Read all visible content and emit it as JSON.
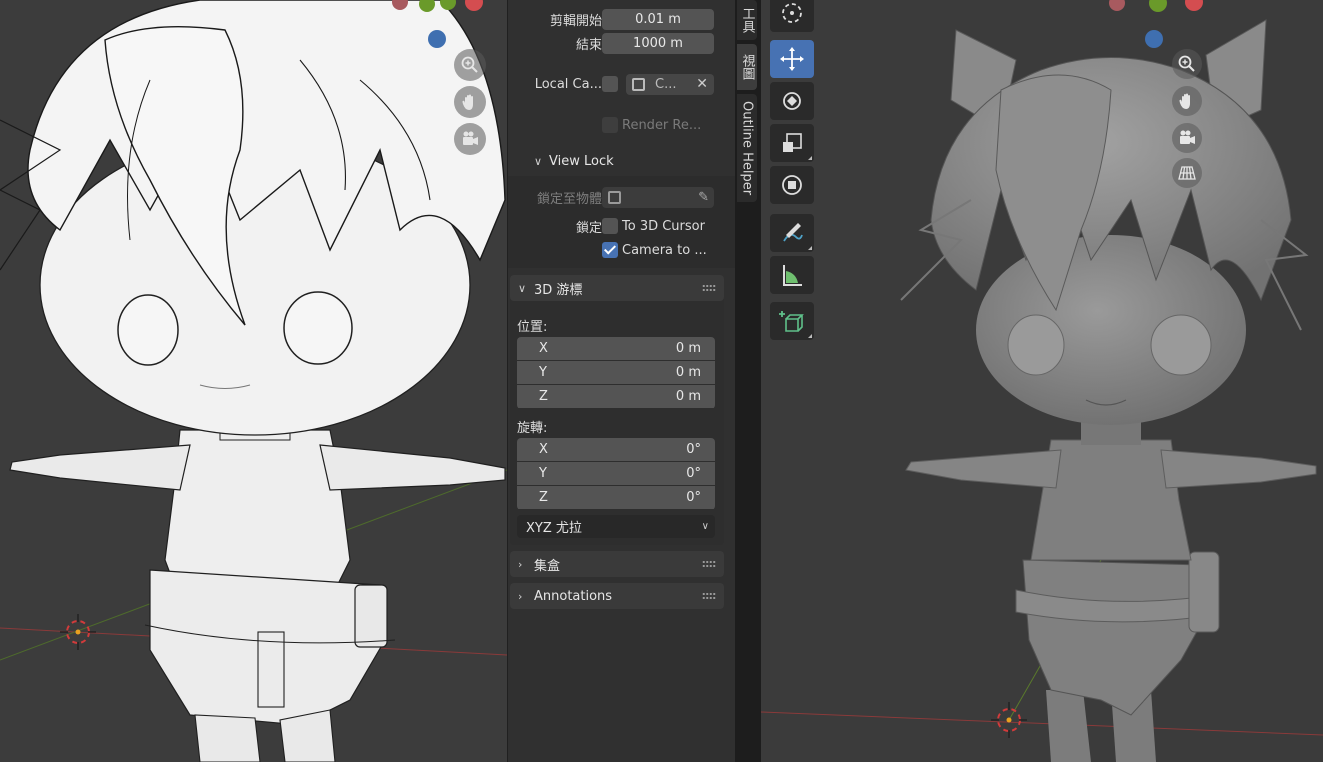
{
  "npanel": {
    "clip_start_label": "剪輯開始",
    "clip_start_value": "0.01 m",
    "clip_end_label": "結束",
    "clip_end_value": "1000 m",
    "local_camera_label": "Local Ca...",
    "local_camera_value": "C...",
    "render_region_label": "Render Re...",
    "view_lock": {
      "title": "View Lock",
      "lock_to_object_label": "鎖定至物體",
      "lock_label": "鎖定",
      "to_3d_cursor_label": "To 3D Cursor",
      "to_3d_cursor_checked": false,
      "camera_to_view_label": "Camera to ...",
      "camera_to_view_checked": true
    },
    "cursor3d": {
      "title": "3D 游標",
      "location_label": "位置:",
      "location": [
        {
          "axis": "X",
          "value": "0 m"
        },
        {
          "axis": "Y",
          "value": "0 m"
        },
        {
          "axis": "Z",
          "value": "0 m"
        }
      ],
      "rotation_label": "旋轉:",
      "rotation": [
        {
          "axis": "X",
          "value": "0°"
        },
        {
          "axis": "Y",
          "value": "0°"
        },
        {
          "axis": "Z",
          "value": "0°"
        }
      ],
      "rotation_mode": "XYZ 尤拉"
    },
    "collections_title": "集盒",
    "annotations_title": "Annotations"
  },
  "tabs": [
    "工具",
    "視圖",
    "Outline Helper"
  ],
  "active_tab": "視圖",
  "colors": {
    "accent": "#4772b3",
    "x_axis": "#c8504b",
    "y_axis": "#7aa83a",
    "z_axis": "#3f6fb0"
  },
  "toolbar": {
    "tools": [
      "cursor-icon",
      "move-icon",
      "rotate-icon",
      "scale-icon",
      "transform-icon",
      "annotate-icon",
      "measure-icon",
      "add-cube-icon"
    ],
    "active": "move-icon"
  }
}
